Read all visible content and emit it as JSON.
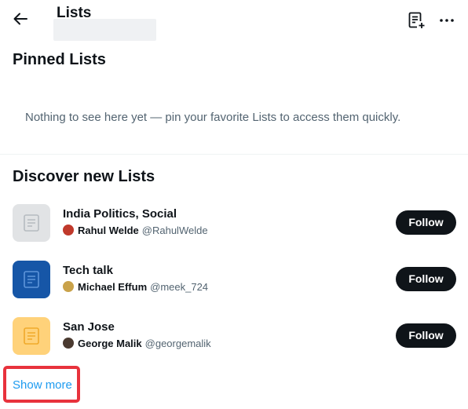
{
  "header": {
    "title": "Lists",
    "back_icon": "arrow-left-icon",
    "new_list_icon": "new-list-icon",
    "more_icon": "more-horizontal-icon"
  },
  "pinned": {
    "title": "Pinned Lists",
    "empty_message": "Nothing to see here yet — pin your favorite Lists to access them quickly."
  },
  "discover": {
    "title": "Discover new Lists",
    "items": [
      {
        "name": "India Politics, Social",
        "owner_name": "Rahul Welde",
        "owner_handle": "@RahulWelde",
        "follow_label": "Follow",
        "thumb_color": "#e1e3e5",
        "icon_color": "#b6bbc0",
        "avatar_color": "#c0392b"
      },
      {
        "name": "Tech talk",
        "owner_name": "Michael Effum",
        "owner_handle": "@meek_724",
        "follow_label": "Follow",
        "thumb_color": "#1656a7",
        "icon_color": "#5e95da",
        "avatar_color": "#c9a24a"
      },
      {
        "name": "San Jose",
        "owner_name": "George Malik",
        "owner_handle": "@georgemalik",
        "follow_label": "Follow",
        "thumb_color": "#ffd27a",
        "icon_color": "#f0a92a",
        "avatar_color": "#4a3a30"
      }
    ]
  },
  "show_more": "Show more",
  "colors": {
    "accent": "#1d9bf0",
    "highlight_box": "#e8323c",
    "button_bg": "#0f1419"
  }
}
